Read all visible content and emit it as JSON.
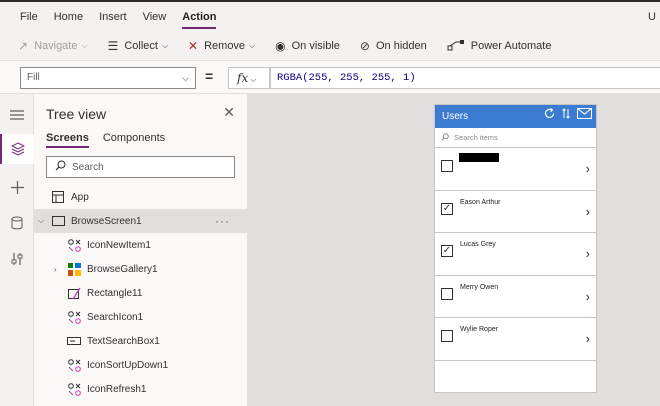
{
  "menu": {
    "items": [
      "File",
      "Home",
      "Insert",
      "View",
      "Action"
    ],
    "active": "Action",
    "right_text": "U"
  },
  "commands": {
    "navigate": "Navigate",
    "collect": "Collect",
    "remove": "Remove",
    "on_visible": "On visible",
    "on_hidden": "On hidden",
    "power_automate": "Power Automate"
  },
  "formula": {
    "property": "Fill",
    "equals": "=",
    "fx_label": "fx",
    "value": "RGBA(255, 255, 255, 1)"
  },
  "tree": {
    "title": "Tree view",
    "tabs": [
      "Screens",
      "Components"
    ],
    "search_placeholder": "Search",
    "app_label": "App",
    "screen": "BrowseScreen1",
    "items": [
      {
        "label": "IconNewItem1",
        "icon": "control-icon"
      },
      {
        "label": "BrowseGallery1",
        "icon": "gallery-icon"
      },
      {
        "label": "Rectangle11",
        "icon": "rectangle-icon"
      },
      {
        "label": "SearchIcon1",
        "icon": "control-icon"
      },
      {
        "label": "TextSearchBox1",
        "icon": "textbox-icon"
      },
      {
        "label": "IconSortUpDown1",
        "icon": "control-icon"
      },
      {
        "label": "IconRefresh1",
        "icon": "control-icon"
      }
    ]
  },
  "app": {
    "title": "Users",
    "search_placeholder": "Search items",
    "gallery": [
      {
        "name": "",
        "checked": false,
        "redacted": true
      },
      {
        "name": "Eason Arthur",
        "checked": true
      },
      {
        "name": "Lucas Grey",
        "checked": true
      },
      {
        "name": "Merry Owen",
        "checked": false
      },
      {
        "name": "Wylie Roper",
        "checked": false
      }
    ]
  },
  "colors": {
    "accent": "#742774",
    "app_header": "#3b7bd1"
  }
}
